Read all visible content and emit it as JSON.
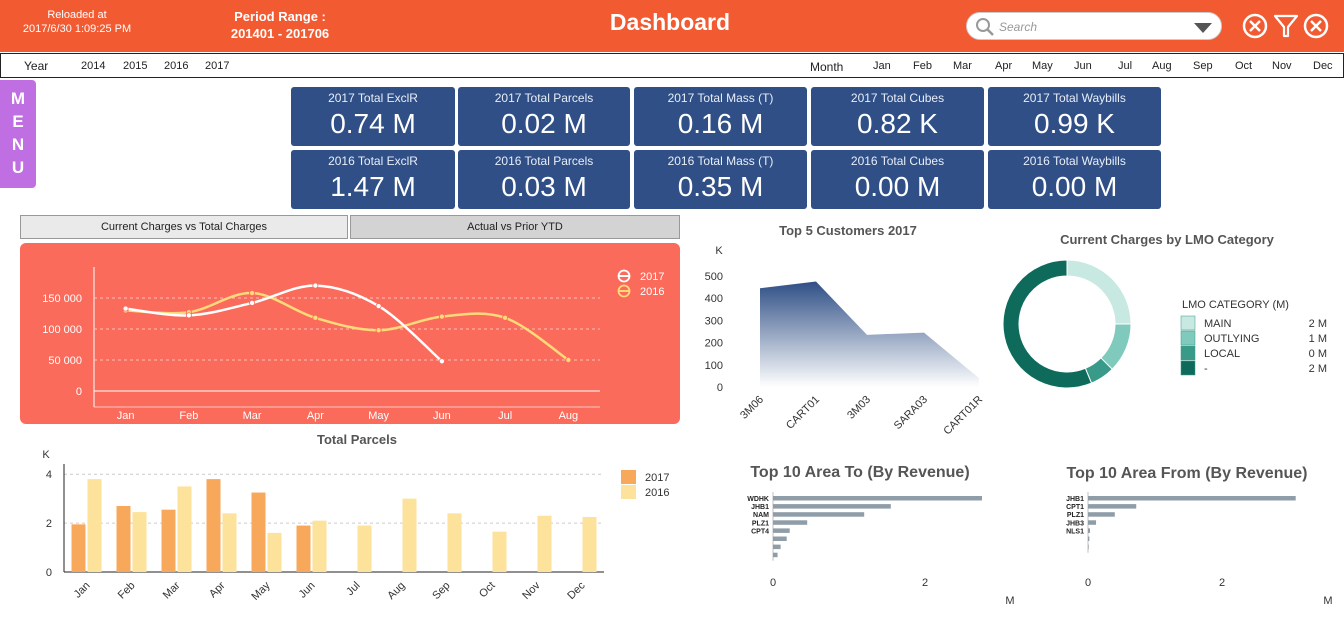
{
  "header": {
    "reloaded_label": "Reloaded at",
    "reloaded_value": "2017/6/30 1:09:25 PM",
    "period_label": "Period Range :",
    "period_value": "201401 - 201706",
    "title": "Dashboard",
    "search_placeholder": "Search",
    "accent_color": "#f25a32"
  },
  "filter_bar": {
    "year_label": "Year",
    "years": [
      "2014",
      "2015",
      "2016",
      "2017"
    ],
    "month_label": "Month",
    "months": [
      "Jan",
      "Feb",
      "Mar",
      "Apr",
      "May",
      "Jun",
      "Jul",
      "Aug",
      "Sep",
      "Oct",
      "Nov",
      "Dec"
    ]
  },
  "menu": {
    "letters": [
      "M",
      "E",
      "N",
      "U"
    ]
  },
  "kpis": [
    {
      "label": "2017 Total ExclR",
      "value": "0.74 M"
    },
    {
      "label": "2017 Total Parcels",
      "value": "0.02 M"
    },
    {
      "label": "2017 Total  Mass (T)",
      "value": "0.16 M"
    },
    {
      "label": "2017 Total Cubes",
      "value": "0.82 K"
    },
    {
      "label": "2017 Total Waybills",
      "value": "0.99 K"
    },
    {
      "label": "2016 Total ExclR",
      "value": "1.47 M"
    },
    {
      "label": "2016 Total Parcels",
      "value": "0.03 M"
    },
    {
      "label": "2016 Total Mass (T)",
      "value": "0.35 M"
    },
    {
      "label": "2016 Total Cubes",
      "value": "0.00 M"
    },
    {
      "label": "2016 Total Waybills",
      "value": "0.00 M"
    }
  ],
  "tabs": [
    "Current Charges vs Total Charges",
    "Actual vs Prior YTD"
  ],
  "chart_data": [
    {
      "type": "line",
      "title": "",
      "categories": [
        "Jan",
        "Feb",
        "Mar",
        "Apr",
        "May",
        "Jun",
        "Jul",
        "Aug"
      ],
      "y_ticks": [
        "0",
        "50 000",
        "100 000",
        "150 000"
      ],
      "ylim": [
        0,
        200000
      ],
      "series": [
        {
          "name": "2017",
          "color": "#ffffff",
          "values": [
            133000,
            122000,
            142000,
            170000,
            137000,
            48000,
            null,
            null
          ]
        },
        {
          "name": "2016",
          "color": "#ffd97a",
          "values": [
            130000,
            127000,
            158000,
            118000,
            98000,
            120000,
            118000,
            50000
          ]
        }
      ],
      "legend": "top-right",
      "background": "#fa6b5c"
    },
    {
      "type": "area",
      "title": "Top 5 Customers 2017",
      "ylabel": "K",
      "categories": [
        "3M06",
        "CART01",
        "3M03",
        "SARA03",
        "CART01R"
      ],
      "values": [
        445,
        475,
        235,
        245,
        40
      ],
      "y_ticks": [
        "0",
        "100",
        "200",
        "300",
        "400",
        "500"
      ],
      "ylim": [
        0,
        500
      ],
      "color": "#2f4f86"
    },
    {
      "type": "pie",
      "title": "Current Charges by LMO Category",
      "legend_title": "LMO CATEGORY (M)",
      "slices": [
        {
          "label": "MAIN",
          "value": 2,
          "display": "2 M",
          "color": "#c8e8e2"
        },
        {
          "label": "OUTLYING",
          "value": 1,
          "display": "1 M",
          "color": "#7fcabc"
        },
        {
          "label": "LOCAL",
          "value": 0.5,
          "display": "0 M",
          "color": "#3a9a8a"
        },
        {
          "label": "-",
          "value": 4.5,
          "display": "2 M",
          "color": "#0e6b5c"
        }
      ]
    },
    {
      "type": "bar",
      "title": "Total Parcels",
      "ylabel": "K",
      "categories": [
        "Jan",
        "Feb",
        "Mar",
        "Apr",
        "May",
        "Jun",
        "Jul",
        "Aug",
        "Sep",
        "Oct",
        "Nov",
        "Dec"
      ],
      "y_ticks": [
        "0",
        "2",
        "4"
      ],
      "ylim": [
        0,
        4.5
      ],
      "series": [
        {
          "name": "2017",
          "color": "#f7a85b",
          "values": [
            1.95,
            2.7,
            2.55,
            3.8,
            3.25,
            1.9,
            null,
            null,
            null,
            null,
            null,
            null
          ]
        },
        {
          "name": "2016",
          "color": "#fce29a",
          "values": [
            3.8,
            2.45,
            3.5,
            2.4,
            1.6,
            2.1,
            1.9,
            3.0,
            2.4,
            1.65,
            2.3,
            2.25
          ]
        }
      ]
    },
    {
      "type": "bar",
      "title": "Top 10 Area To (By Revenue)",
      "xlabel": "M",
      "categories": [
        "WDHK",
        "JHB1",
        "NAM",
        "PLZ1",
        "CPT4",
        "",
        "",
        ""
      ],
      "values": [
        2.75,
        1.55,
        1.2,
        0.45,
        0.22,
        0.18,
        0.1,
        0.06
      ],
      "x_ticks": [
        "0",
        "2"
      ],
      "xlim": [
        0,
        3
      ],
      "color": "#8f9da8"
    },
    {
      "type": "bar",
      "title": "Top 10 Area From (By Revenue)",
      "xlabel": "M",
      "categories": [
        "JHB1",
        "CPT1",
        "PLZ1",
        "JHB3",
        "NLS1",
        "",
        ""
      ],
      "values": [
        3.1,
        0.72,
        0.4,
        0.12,
        0.03,
        0.02,
        0.01
      ],
      "x_ticks": [
        "0",
        "2"
      ],
      "xlim": [
        0,
        3.5
      ],
      "color": "#8f9da8"
    }
  ]
}
